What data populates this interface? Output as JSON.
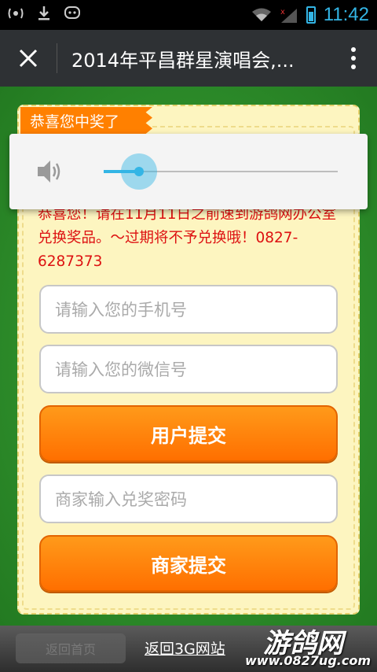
{
  "status_bar": {
    "time": "11:42",
    "icons": [
      "usb-debug-icon",
      "download-icon",
      "message-icon",
      "wifi-icon",
      "signal-icon",
      "battery-icon"
    ]
  },
  "title_bar": {
    "title": "2014年平昌群星演唱会,..."
  },
  "card": {
    "congrats_label": "恭喜您中奖了",
    "message": "恭喜您！请在11月11日之前速到游鸽网办公室兑换奖品。～过期将不予兑换哦！0827-6287373",
    "phone_placeholder": "请输入您的手机号",
    "wechat_placeholder": "请输入您的微信号",
    "user_submit_label": "用户提交",
    "merchant_code_placeholder": "商家输入兑奖密码",
    "merchant_submit_label": "商家提交"
  },
  "volume": {
    "level": 0.15
  },
  "footer": {
    "back_link": "返回3G网站",
    "ghost_button": "返回首页",
    "watermark_title": "游鸽网",
    "watermark_url": "www.0827ug.com"
  },
  "colors": {
    "accent": "#33b5e5",
    "orange": "#ff8000",
    "message_red": "#dd1111",
    "page_green": "#2f8a2d"
  }
}
